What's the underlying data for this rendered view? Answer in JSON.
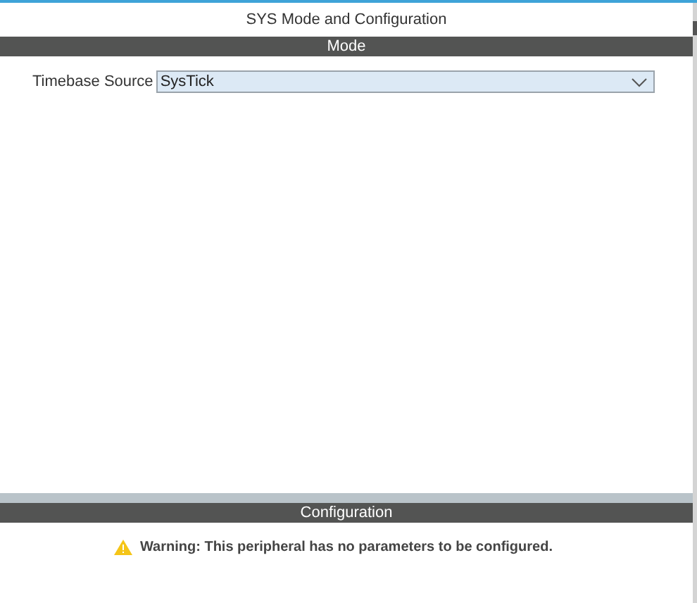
{
  "title": "SYS Mode and Configuration",
  "mode_section": {
    "header": "Mode",
    "fields": [
      {
        "label": "Timebase Source",
        "value": "SysTick"
      }
    ]
  },
  "configuration_section": {
    "header": "Configuration",
    "warning": "Warning: This peripheral has no parameters to be configured."
  }
}
